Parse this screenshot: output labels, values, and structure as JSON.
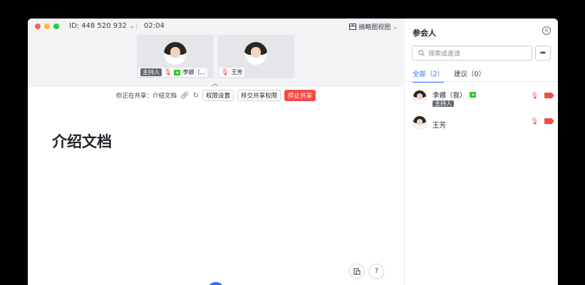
{
  "meeting": {
    "id_label": "ID: 448 520 932",
    "timer": "02:04",
    "view_switch_label": "摘略图视图"
  },
  "tiles": [
    {
      "name": "李娜（…",
      "host_label": "主持人"
    },
    {
      "name": "王芳"
    }
  ],
  "share_bar": {
    "label": "你正在共享：介绍文档",
    "permission_button": "权限设置",
    "transfer_button": "移交共享权限",
    "stop_button": "停止共享"
  },
  "document": {
    "title": "介绍文档"
  },
  "panel": {
    "title": "参会人",
    "search_placeholder": "搜索或邀请",
    "tabs": [
      {
        "label": "全部（2）",
        "active": true
      },
      {
        "label": "建议（0）",
        "active": false
      }
    ],
    "participants": [
      {
        "name": "李娜（我）",
        "badge": "主持人"
      },
      {
        "name": "王芳"
      }
    ]
  },
  "colors": {
    "accent": "#3370ff",
    "danger": "#f54a45",
    "share_green": "#34c724"
  }
}
